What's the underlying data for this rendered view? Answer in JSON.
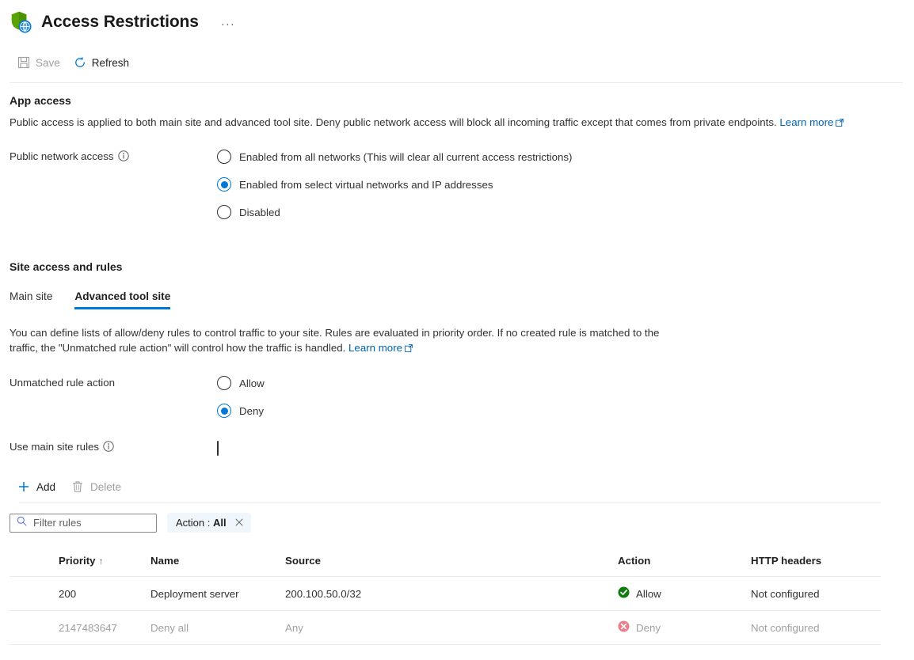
{
  "header": {
    "title": "Access Restrictions",
    "icon": "shield-globe-icon",
    "more_label": "···"
  },
  "commandbar": {
    "save_label": "Save",
    "save_icon": "save-icon",
    "save_enabled": false,
    "refresh_label": "Refresh",
    "refresh_icon": "refresh-icon",
    "refresh_enabled": true
  },
  "app_access": {
    "heading": "App access",
    "description": "Public access is applied to both main site and advanced tool site. Deny public network access will block all incoming traffic except that comes from private endpoints.",
    "learn_more": "Learn more",
    "public_network_access": {
      "label": "Public network access",
      "info_icon": "info-icon",
      "options": [
        {
          "label": "Enabled from all networks (This will clear all current access restrictions)",
          "selected": false
        },
        {
          "label": "Enabled from select virtual networks and IP addresses",
          "selected": true
        },
        {
          "label": "Disabled",
          "selected": false
        }
      ]
    }
  },
  "site_access": {
    "heading": "Site access and rules",
    "tabs": [
      {
        "label": "Main site",
        "active": false
      },
      {
        "label": "Advanced tool site",
        "active": true
      }
    ],
    "description": "You can define lists of allow/deny rules to control traffic to your site. Rules are evaluated in priority order. If no created rule is matched to the traffic, the \"Unmatched rule action\" will control how the traffic is handled.",
    "learn_more": "Learn more",
    "unmatched_rule_action": {
      "label": "Unmatched rule action",
      "options": [
        {
          "label": "Allow",
          "selected": false
        },
        {
          "label": "Deny",
          "selected": true
        }
      ]
    },
    "use_main_site_rules": {
      "label": "Use main site rules",
      "info_icon": "info-icon",
      "checked": false
    }
  },
  "list_commands": {
    "add_label": "Add",
    "add_icon": "plus-icon",
    "add_enabled": true,
    "delete_label": "Delete",
    "delete_icon": "trash-icon",
    "delete_enabled": false
  },
  "filters": {
    "search_placeholder": "Filter rules",
    "search_value": "",
    "search_icon": "search-icon",
    "pill": {
      "label": "Action :",
      "value": "All",
      "clear_icon": "close-icon"
    }
  },
  "rules_table": {
    "columns": [
      {
        "label": "Priority",
        "sort": "↑"
      },
      {
        "label": "Name",
        "sort": ""
      },
      {
        "label": "Source",
        "sort": ""
      },
      {
        "label": "Action",
        "sort": ""
      },
      {
        "label": "HTTP headers",
        "sort": ""
      }
    ],
    "rows": [
      {
        "priority": "200",
        "name": "Deployment server",
        "source": "200.100.50.0/32",
        "action": "Allow",
        "action_icon": "check-circle-icon",
        "http_headers": "Not configured",
        "disabled": false
      },
      {
        "priority": "2147483647",
        "name": "Deny all",
        "source": "Any",
        "action": "Deny",
        "action_icon": "x-circle-icon",
        "http_headers": "Not configured",
        "disabled": true
      }
    ]
  },
  "colors": {
    "accent": "#0078d4",
    "link": "#0063b1",
    "allow_green": "#107c10",
    "deny_red": "#e8808c",
    "pill_bg": "#eff6fc",
    "disabled_text": "#a19f9d"
  }
}
